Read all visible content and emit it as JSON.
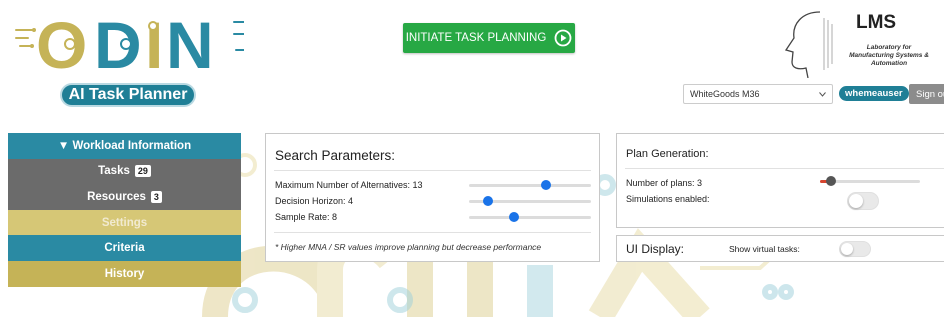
{
  "header": {
    "logo_text": "ODIN",
    "subtitle": "AI Task Planner",
    "initiate_label": "INITIATE TASK PLANNING",
    "lms": {
      "title": "LMS",
      "subtitle": "Laboratory for Manufacturing Systems & Automation"
    },
    "plant_select": {
      "value": "WhiteGoods M36"
    },
    "user": "whemeauser",
    "signout_label": "Sign out"
  },
  "sidebar": {
    "items": [
      {
        "label": "▼  Workload Information",
        "style": "blue"
      },
      {
        "label": "Tasks",
        "count": "29",
        "style": "gray"
      },
      {
        "label": "Resources",
        "count": "3",
        "style": "gray"
      },
      {
        "label": "Settings",
        "style": "gold-light"
      },
      {
        "label": "Criteria",
        "style": "blue"
      },
      {
        "label": "History",
        "style": "gold"
      }
    ]
  },
  "search": {
    "title": "Search Parameters:",
    "params": [
      {
        "label": "Maximum Number of Alternatives: 13",
        "value": 13,
        "min": 1,
        "max": 20
      },
      {
        "label": "Decision Horizon: 4",
        "value": 4,
        "min": 1,
        "max": 20
      },
      {
        "label": "Sample Rate: 8",
        "value": 8,
        "min": 1,
        "max": 20
      }
    ],
    "note": "* Higher MNA / SR values improve planning but decrease performance"
  },
  "plan": {
    "title": "Plan Generation:",
    "plans_label": "Number of plans: 3",
    "plans_value": 3,
    "plans_min": 1,
    "plans_max": 20,
    "sim_label": "Simulations enabled:",
    "sim_enabled": false
  },
  "ui_display": {
    "title": "UI Display:",
    "virtual_label": "Show virtual tasks:",
    "virtual_enabled": false
  },
  "colors": {
    "teal": "#2a8aa3",
    "gold": "#c5b357",
    "gray": "#6b6b6b",
    "green": "#27a844",
    "slider_blue": "#1a73e8",
    "slider_red": "#d6452f"
  }
}
